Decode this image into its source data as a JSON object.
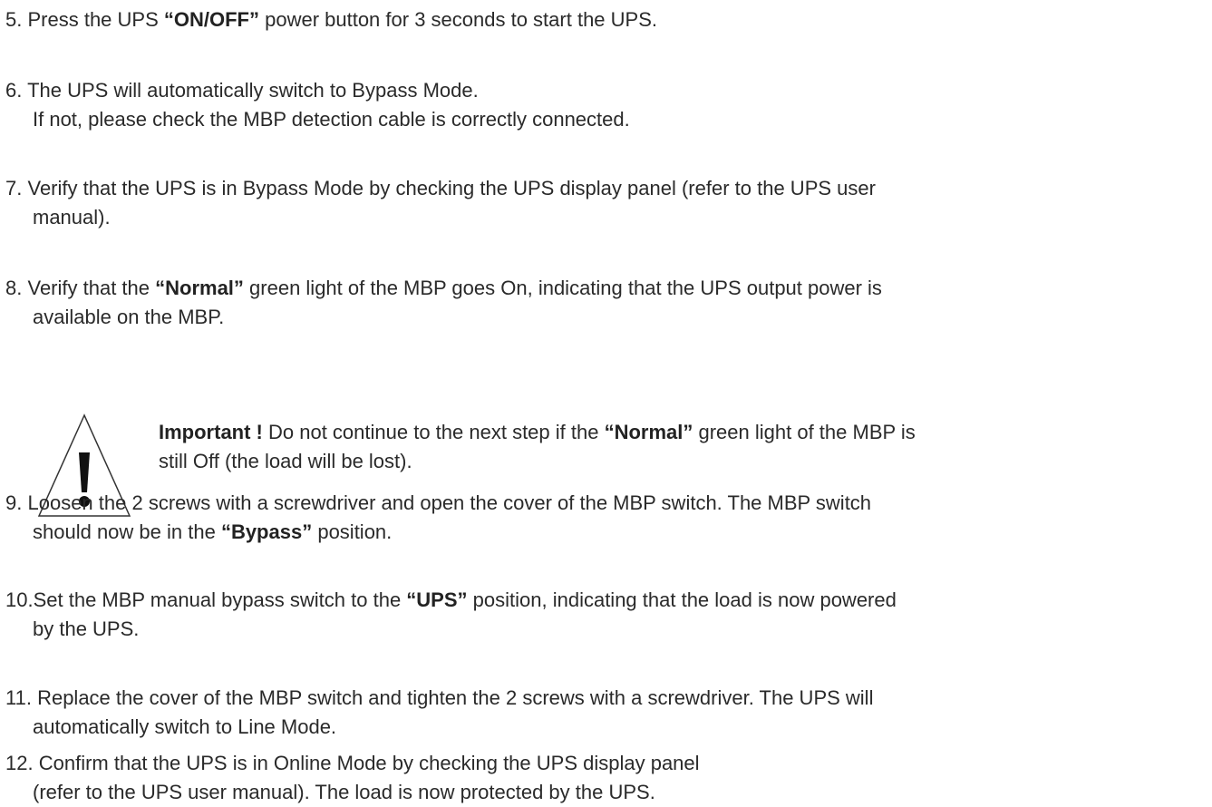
{
  "steps": [
    {
      "number": "5.",
      "parts": [
        "Press the UPS ",
        "“ON/OFF”",
        " power button for 3 seconds to start the UPS."
      ]
    },
    {
      "number": "6.",
      "line1": "The UPS will automatically switch to Bypass Mode.",
      "line2": "If not, please check the MBP detection cable is correctly connected."
    },
    {
      "number": "7.",
      "line1": "Verify that the UPS is in Bypass Mode by checking the UPS display panel (refer to the UPS user",
      "line2": "manual)."
    },
    {
      "number": "8.",
      "parts": [
        "Verify that the ",
        "“Normal”",
        " green light of the MBP goes On, indicating that the UPS output power is"
      ],
      "line2": "available on the MBP."
    },
    {
      "number": "9.",
      "line1": "Loosen the 2 screws with a screwdriver and open the cover of the MBP switch. The MBP switch",
      "parts2": [
        "should now be in the ",
        "“Bypass”",
        " position."
      ]
    },
    {
      "number": "10.",
      "parts": [
        "Set the MBP manual bypass switch to the ",
        "“UPS”",
        " position, indicating that the load is now powered"
      ],
      "line2": "by the UPS."
    },
    {
      "number": "11.",
      "line1": "Replace the cover of the MBP switch and tighten the 2 screws with a screwdriver. The UPS will",
      "line2": "automatically switch to Line Mode."
    },
    {
      "number": "12.",
      "line1": "Confirm that the UPS is in Online Mode by checking the UPS display panel",
      "line2": "(refer to the UPS user manual). The load is now protected by the UPS."
    }
  ],
  "warning": {
    "icon": "warning-triangle-icon",
    "label": "Important !",
    "parts": [
      " Do not continue to the next step if the ",
      "“Normal”",
      " green light of the MBP is"
    ],
    "line2": "still Off (the load will be lost)."
  }
}
